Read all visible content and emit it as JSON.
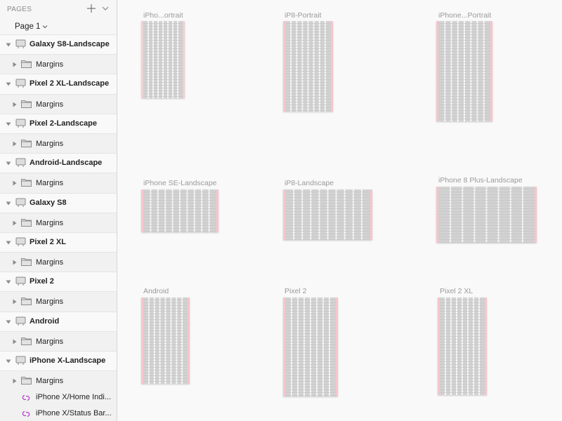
{
  "pages_panel": {
    "title": "PAGES",
    "add_icon": "plus-icon",
    "collapse_icon": "chevron-down-icon",
    "current_page": "Page 1"
  },
  "layers": [
    {
      "type": "artboard",
      "label": "Galaxy S8-Landscape",
      "icon": "artboard-icon"
    },
    {
      "type": "group",
      "label": "Margins",
      "icon": "folder-icon"
    },
    {
      "type": "artboard",
      "label": "Pixel 2 XL-Landscape",
      "icon": "artboard-icon"
    },
    {
      "type": "group",
      "label": "Margins",
      "icon": "folder-icon"
    },
    {
      "type": "artboard",
      "label": "Pixel 2-Landscape",
      "icon": "artboard-icon"
    },
    {
      "type": "group",
      "label": "Margins",
      "icon": "folder-icon"
    },
    {
      "type": "artboard",
      "label": "Android-Landscape",
      "icon": "artboard-icon"
    },
    {
      "type": "group",
      "label": "Margins",
      "icon": "folder-icon"
    },
    {
      "type": "artboard",
      "label": "Galaxy S8",
      "icon": "artboard-icon"
    },
    {
      "type": "group",
      "label": "Margins",
      "icon": "folder-icon"
    },
    {
      "type": "artboard",
      "label": "Pixel 2 XL",
      "icon": "artboard-icon"
    },
    {
      "type": "group",
      "label": "Margins",
      "icon": "folder-icon"
    },
    {
      "type": "artboard",
      "label": "Pixel 2",
      "icon": "artboard-icon"
    },
    {
      "type": "group",
      "label": "Margins",
      "icon": "folder-icon"
    },
    {
      "type": "artboard",
      "label": "Android",
      "icon": "artboard-icon"
    },
    {
      "type": "group",
      "label": "Margins",
      "icon": "folder-icon"
    },
    {
      "type": "artboard",
      "label": "iPhone X-Landscape",
      "icon": "artboard-icon"
    },
    {
      "type": "group",
      "label": "Margins",
      "icon": "folder-icon"
    },
    {
      "type": "symbol",
      "label": "iPhone X/Home Indi...",
      "icon": "symbol-icon"
    },
    {
      "type": "symbol",
      "label": "iPhone X/Status Bar...",
      "icon": "symbol-icon"
    }
  ],
  "artboards": [
    {
      "title": "iPho...ortrait",
      "columns": 8,
      "margin_color": "#f0d0d4"
    },
    {
      "title": "iP8-Portrait",
      "columns": 8,
      "margin_color": "#f7c5cc"
    },
    {
      "title": "iPhone...Portrait",
      "columns": 8,
      "margin_color": "#f7c5cc"
    },
    {
      "title": "iPhone SE-Landscape",
      "columns": 10,
      "margin_color": "#f7c5cc"
    },
    {
      "title": "iP8-Landscape",
      "columns": 10,
      "margin_color": "#f7c5cc"
    },
    {
      "title": "iPhone 8 Plus-Landscape",
      "columns": 8,
      "margin_color": "#f7c5cc"
    },
    {
      "title": "Android",
      "columns": 8,
      "margin_color": "#f7c5cc"
    },
    {
      "title": "Pixel 2",
      "columns": 8,
      "margin_color": "#f7c5cc"
    },
    {
      "title": "Pixel 2 XL",
      "columns": 8,
      "margin_color": "#f7c5cc"
    }
  ],
  "colors": {
    "grid_fill": "#d2d2d2",
    "gutter": "#ffffff",
    "symbol_accent": "#b23cc8"
  }
}
